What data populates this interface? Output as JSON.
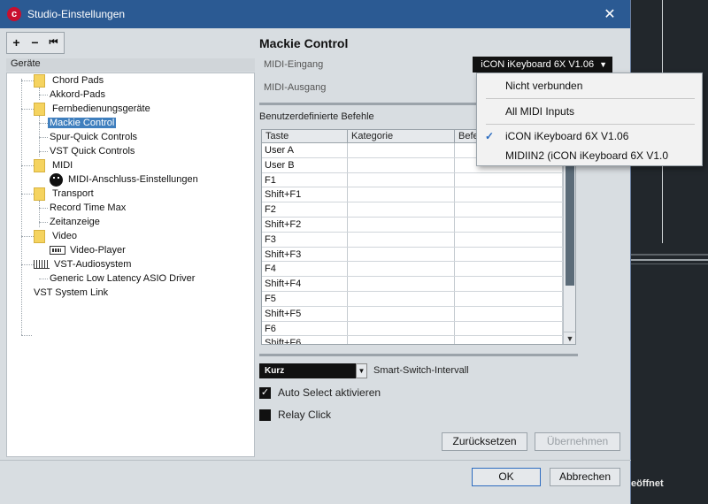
{
  "window": {
    "title": "Studio-Einstellungen"
  },
  "toolbar": {
    "add": "+",
    "remove": "−",
    "reset": "⏮"
  },
  "tree": {
    "header": "Geräte",
    "nodes": [
      {
        "label": "Chord Pads"
      },
      {
        "label": "Akkord-Pads"
      },
      {
        "label": "Fernbedienungsgeräte"
      },
      {
        "label": "Mackie Control"
      },
      {
        "label": "Spur-Quick Controls"
      },
      {
        "label": "VST Quick Controls"
      },
      {
        "label": "MIDI"
      },
      {
        "label": "MIDI-Anschluss-Einstellungen"
      },
      {
        "label": "Transport"
      },
      {
        "label": "Record Time Max"
      },
      {
        "label": "Zeitanzeige"
      },
      {
        "label": "Video"
      },
      {
        "label": "Video-Player"
      },
      {
        "label": "VST-Audiosystem"
      },
      {
        "label": "Generic Low Latency ASIO Driver"
      },
      {
        "label": "VST System Link"
      }
    ]
  },
  "panel": {
    "title": "Mackie Control",
    "midi_in_label": "MIDI-Eingang",
    "midi_out_label": "MIDI-Ausgang",
    "midi_in_value": "iCON iKeyboard 6X V1.06",
    "commands_title": "Benutzerdefinierte Befehle",
    "smart_switch_value": "Kurz",
    "smart_switch_label": "Smart-Switch-Intervall",
    "auto_select_label": "Auto Select aktivieren",
    "relay_click_label": "Relay Click",
    "reset_button": "Zurücksetzen",
    "apply_button": "Übernehmen"
  },
  "table": {
    "columns": [
      "Taste",
      "Kategorie",
      "Befe"
    ],
    "rows": [
      "User A",
      "User B",
      "F1",
      "Shift+F1",
      "F2",
      "Shift+F2",
      "F3",
      "Shift+F3",
      "F4",
      "Shift+F4",
      "F5",
      "Shift+F5",
      "F6",
      "Shift+F6"
    ]
  },
  "popup": {
    "items": [
      {
        "label": "Nicht verbunden",
        "checked": false
      },
      {
        "label": "All MIDI Inputs",
        "checked": false
      },
      {
        "label": "iCON iKeyboard 6X V1.06",
        "checked": true
      },
      {
        "label": "MIDIIN2 (iCON iKeyboard 6X V1.0",
        "checked": false
      }
    ]
  },
  "footer": {
    "ok": "OK",
    "cancel": "Abbrechen"
  },
  "background": {
    "text": "eöffnet"
  },
  "colors": {
    "titlebar": "#2b5a93",
    "selection": "#3f7fbe",
    "check_accent": "#2b6cc0"
  }
}
